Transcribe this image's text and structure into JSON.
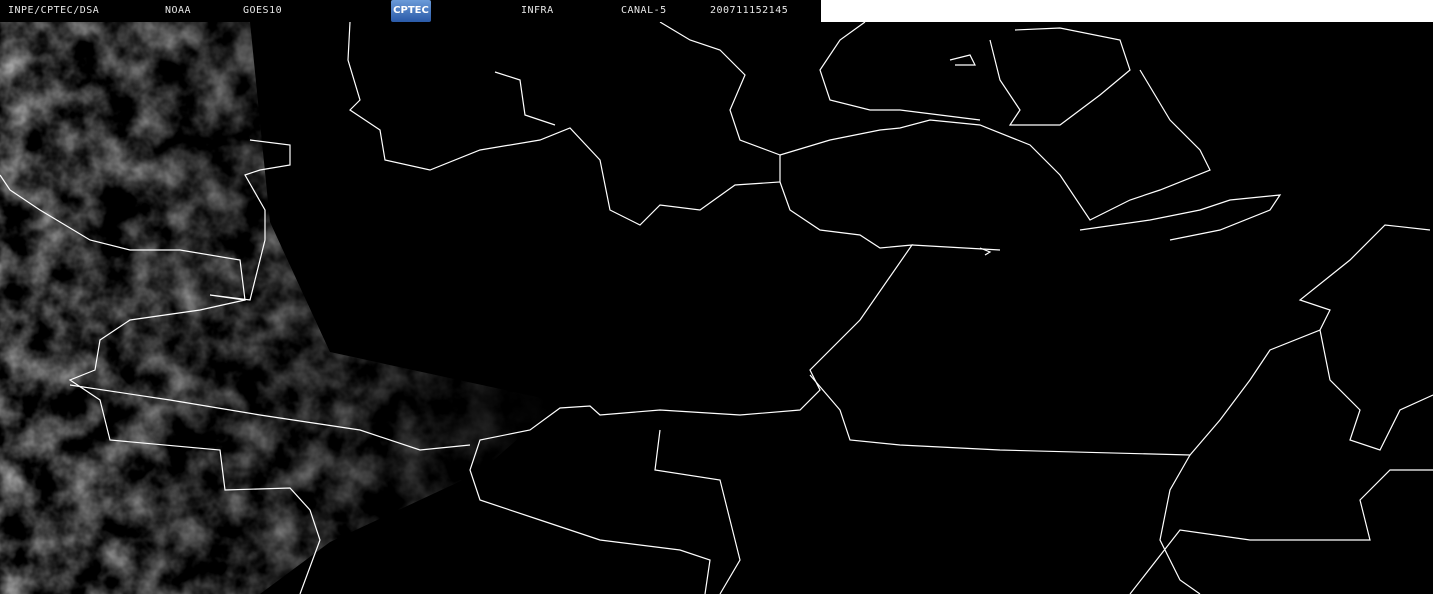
{
  "header": {
    "institution": "INPE/CPTEC/DSA",
    "agency": "NOAA",
    "satellite": "GOES10",
    "logo_text": "CPTEC",
    "band_type": "INFRA",
    "channel": "CANAL-5",
    "datetime": "200711152145"
  },
  "colors": {
    "background": "#000000",
    "borders": "#ffffff",
    "text": "#e8e8e8"
  }
}
